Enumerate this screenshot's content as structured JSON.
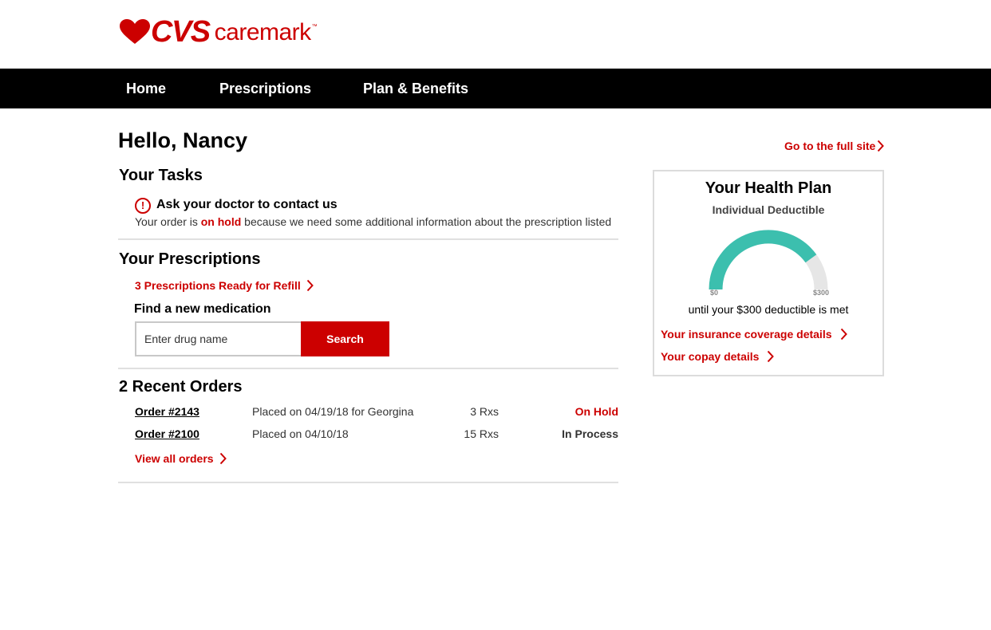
{
  "brand": {
    "name_bold": "CVS",
    "name_light": "caremark",
    "trademark": "™",
    "color": "#cc0000"
  },
  "nav": {
    "items": [
      {
        "label": "Home"
      },
      {
        "label": "Prescriptions"
      },
      {
        "label": "Plan & Benefits"
      }
    ]
  },
  "greeting": "Hello, Nancy",
  "full_site_link": "Go to the full site",
  "tasks": {
    "title": "Your Tasks",
    "item": {
      "icon": "alert-icon",
      "title": "Ask your doctor to contact us",
      "desc_prefix": "Your order is ",
      "desc_status": "on hold",
      "desc_suffix": " because we need some additional information about the prescription listed"
    }
  },
  "prescriptions": {
    "title": "Your Prescriptions",
    "refill_link": "3 Prescriptions Ready for Refill",
    "find_label": "Find a new medication",
    "search_placeholder": "Enter drug name",
    "search_button": "Search"
  },
  "orders": {
    "title": "2 Recent Orders",
    "rows": [
      {
        "number": "Order #2143",
        "placed": "Placed on 04/19/18 for Georgina",
        "rx": "3 Rxs",
        "status": "On Hold",
        "status_color": "#cc0000"
      },
      {
        "number": "Order #2100",
        "placed": "Placed on 04/10/18",
        "rx": "15 Rxs",
        "status": "In Process",
        "status_color": "#333333"
      }
    ],
    "view_all": "View all orders"
  },
  "health_plan": {
    "title": "Your Health Plan",
    "subtitle": "Individual Deductible",
    "gauge_min_label": "$0",
    "gauge_max_label": "$300",
    "gauge_fraction": 0.8,
    "gauge_color": "#3cbfae",
    "gauge_track_color": "#e6e6e6",
    "until_text": "until your $300 deductible is met",
    "coverage_link": "Your insurance coverage details",
    "copay_link": "Your copay details"
  }
}
